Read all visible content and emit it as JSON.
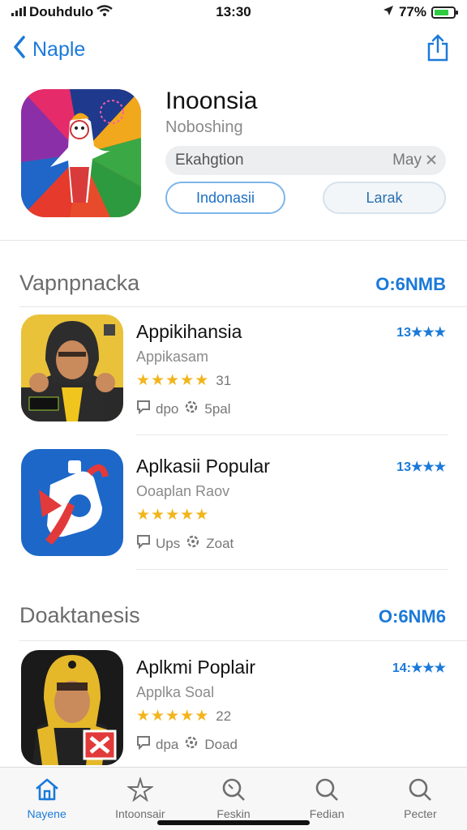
{
  "status_bar": {
    "carrier": "Douhdulo",
    "time": "13:30",
    "battery": "77%",
    "battery_level": 0.77
  },
  "nav": {
    "back_label": "Naple"
  },
  "app": {
    "title": "Inoonsia",
    "subtitle": "Noboshing",
    "search": {
      "value": "Ekahgtion",
      "right_text": "May"
    },
    "primary_button": "Indonasii",
    "secondary_button": "Larak"
  },
  "sections": [
    {
      "title": "Vapnpnacka",
      "link": "O:6NMB",
      "items": [
        {
          "name": "Appikihansia",
          "subtitle": "Appikasam",
          "rating": 4.5,
          "rating_count": "31",
          "meta_a": "dpo",
          "meta_b": "5pal",
          "right": "13★★★"
        },
        {
          "name": "Aplkasii Popular",
          "subtitle": "Ooaplan Raov",
          "rating": 4.5,
          "rating_count": "",
          "meta_a": "Ups",
          "meta_b": "Zoat",
          "right": "13★★★"
        }
      ]
    },
    {
      "title": "Doaktanesis",
      "link": "O:6NM6",
      "items": [
        {
          "name": "Aplkmi Poplair",
          "subtitle": "Applka Soal",
          "rating": 4.5,
          "rating_count": "22",
          "meta_a": "dpa",
          "meta_b": "Doad",
          "right": "14:★★★"
        }
      ]
    }
  ],
  "tabs": [
    {
      "label": "Nayene",
      "icon": "home-icon",
      "active": true
    },
    {
      "label": "Intoonsair",
      "icon": "sparkle-icon",
      "active": false
    },
    {
      "label": "Feskin",
      "icon": "magnifier-icon",
      "active": false
    },
    {
      "label": "Fedian",
      "icon": "search-icon",
      "active": false
    },
    {
      "label": "Pecter",
      "icon": "search-icon",
      "active": false
    }
  ],
  "colors": {
    "accent": "#1b7ad9",
    "star": "#f2b51c"
  }
}
